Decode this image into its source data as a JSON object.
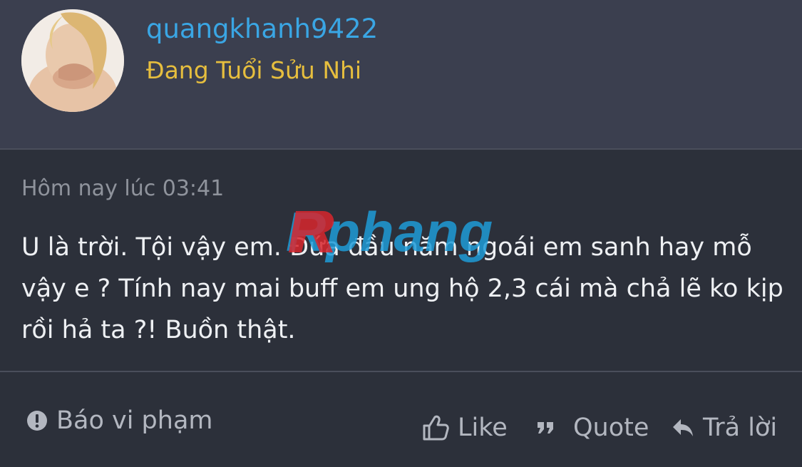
{
  "user": {
    "username": "quangkhanh9422",
    "title": "Đang Tuổi Sửu Nhi",
    "avatar_icon": "user-avatar-photo"
  },
  "post": {
    "timestamp": "Hôm nay lúc 03:41",
    "message": "U là trời. Tội vậy em. Đứa đầu năm ngoái em sanh hay mỗ vậy e ? Tính nay mai buff em ung hộ 2,3 cái mà chả lẽ ko kịp rồi hả ta ?! Buồn thật.",
    "watermark": "Rphang"
  },
  "actions": {
    "report_label": "Báo vi phạm",
    "report_icon": "exclamation-circle-icon",
    "like_label": "Like",
    "like_icon": "thumbs-up-icon",
    "quote_label": "Quote",
    "quote_icon": "quote-icon",
    "reply_label": "Trả lời",
    "reply_icon": "reply-arrow-icon"
  },
  "colors": {
    "header_bg": "#3b3f4f",
    "body_bg": "#2c303a",
    "username": "#3aa6e4",
    "title": "#e6be3e",
    "text": "#eef0f3",
    "muted": "#8f939c",
    "action": "#b3b7c0"
  }
}
